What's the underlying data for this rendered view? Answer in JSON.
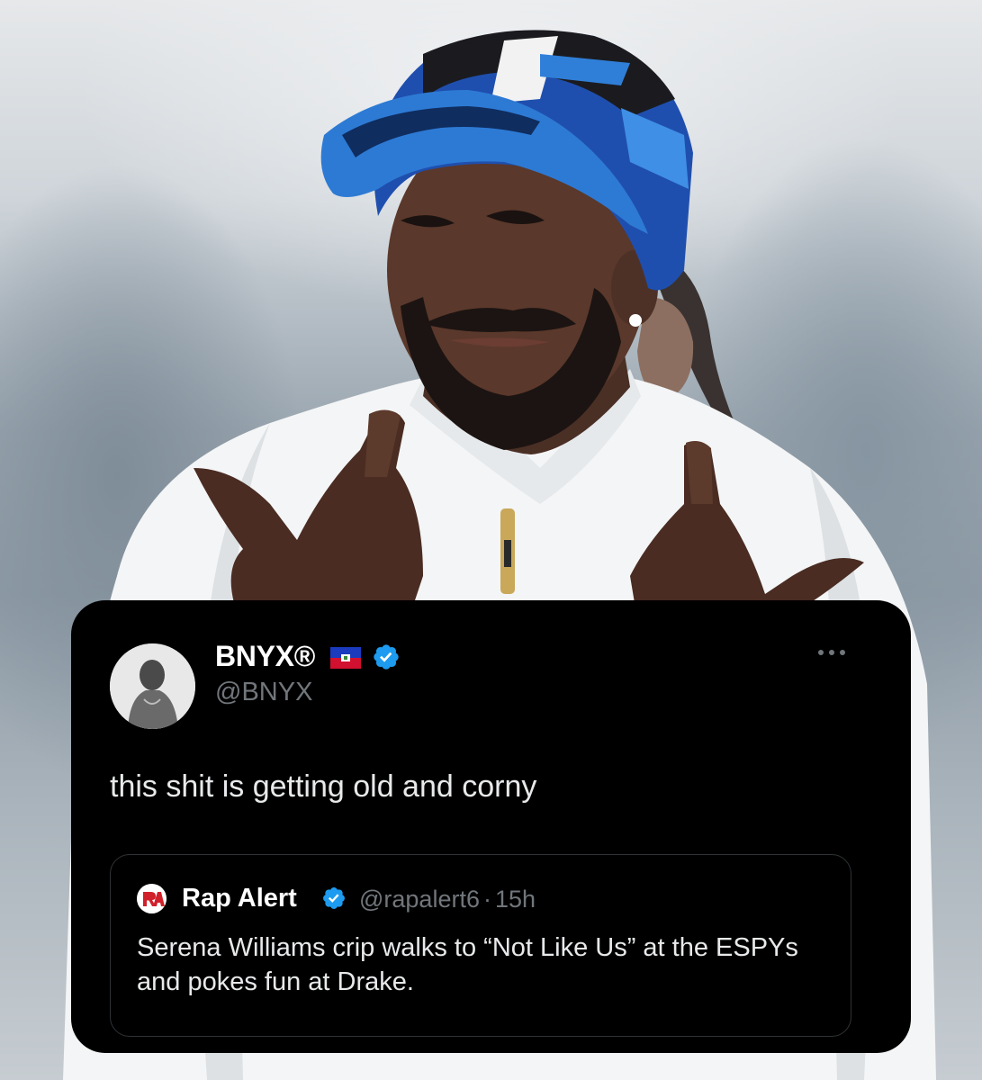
{
  "background": {
    "description_icon": "photo-background"
  },
  "tweet": {
    "display_name": "BNYX®",
    "handle": "@BNYX",
    "flag_icon": "haiti-flag-icon",
    "verified_icon": "verified-badge-icon",
    "more_icon": "more-options-icon",
    "text": "this shit is getting old and corny",
    "colors": {
      "card_bg": "#000000",
      "verified_blue": "#1d9bf0",
      "secondary_text": "#71767b",
      "primary_text": "#e7e9ea"
    }
  },
  "quote": {
    "display_name": "Rap Alert",
    "handle": "@rapalert6",
    "separator": "·",
    "time": "15h",
    "text": "Serena Williams crip walks to “Not Like Us” at the ESPYs and pokes fun at Drake."
  }
}
